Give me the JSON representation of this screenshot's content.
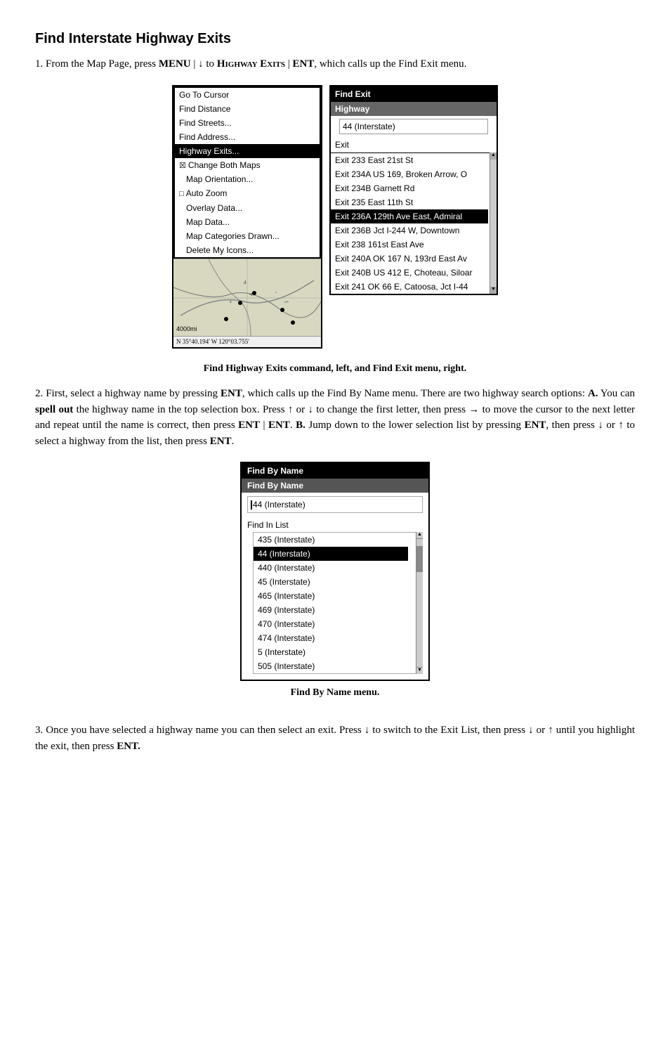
{
  "title": "Find Interstate Highway Exits",
  "paragraph1_parts": [
    {
      "text": "1. From the Map Page, press ",
      "bold": false
    },
    {
      "text": "MENU",
      "bold": true
    },
    {
      "text": " | ↓ to ",
      "bold": false
    },
    {
      "text": "Highway Exits",
      "bold": true,
      "smallcaps": true
    },
    {
      "text": " | ",
      "bold": false
    },
    {
      "text": "ENT",
      "bold": true
    },
    {
      "text": ", which calls up the Find Exit menu.",
      "bold": false
    }
  ],
  "left_menu": {
    "items": [
      {
        "label": "Go To Cursor",
        "type": "normal"
      },
      {
        "label": "Find Distance",
        "type": "normal"
      },
      {
        "label": "Find Streets...",
        "type": "normal"
      },
      {
        "label": "Find Address...",
        "type": "normal"
      },
      {
        "label": "Highway Exits...",
        "type": "selected"
      },
      {
        "label": "Change Both Maps",
        "type": "checkbox"
      },
      {
        "label": "Map Orientation...",
        "type": "normal",
        "indent": true
      },
      {
        "label": "Auto Zoom",
        "type": "checkbox-unchecked"
      },
      {
        "label": "Overlay Data...",
        "type": "normal",
        "indent": true
      },
      {
        "label": "Map Data...",
        "type": "normal",
        "indent": true
      },
      {
        "label": "Map Categories Drawn...",
        "type": "normal",
        "indent": true
      },
      {
        "label": "Delete My Icons...",
        "type": "normal",
        "indent": true
      }
    ],
    "bottom_left": "4000mi",
    "bottom_coords": "N  35°40.194'  W 120°03.755'"
  },
  "find_exit_panel": {
    "header": "Find Exit",
    "subheader": "Highway",
    "input_value": "44 (Interstate)",
    "section_label": "Exit",
    "exits": [
      {
        "label": "Exit 233 East 21st St",
        "selected": false
      },
      {
        "label": "Exit 234A US 169, Broken Arrow, O",
        "selected": false
      },
      {
        "label": "Exit 234B Garnett Rd",
        "selected": false
      },
      {
        "label": "Exit 235 East 11th St",
        "selected": false
      },
      {
        "label": "Exit 236A 129th Ave East, Admiral",
        "selected": true
      },
      {
        "label": "Exit 236B Jct I-244 W, Downtown",
        "selected": false
      },
      {
        "label": "Exit 238 161st East Ave",
        "selected": false
      },
      {
        "label": "Exit 240A OK 167 N, 193rd East Av",
        "selected": false
      },
      {
        "label": "Exit 240B US 412 E, Choteau, Siloar",
        "selected": false
      },
      {
        "label": "Exit 241 OK 66 E, Catoosa, Jct I-44",
        "selected": false
      }
    ]
  },
  "figure1_caption": "Find Highway Exits command, left, and Find Exit menu, right.",
  "paragraph2_parts": [
    {
      "text": "2. First, select a highway name by pressing ",
      "bold": false
    },
    {
      "text": "ENT",
      "bold": true
    },
    {
      "text": ", which calls up the Find By Name menu. There are two highway search options: ",
      "bold": false
    },
    {
      "text": "A.",
      "bold": true
    },
    {
      "text": " You can ",
      "bold": false
    },
    {
      "text": "spell out",
      "bold": true
    },
    {
      "text": " the highway name in the top selection box. Press ↑ or ↓ to change the first letter, then press → to move the cursor to the next letter and repeat until the name is correct, then press ",
      "bold": false
    },
    {
      "text": "ENT",
      "bold": true
    },
    {
      "text": " | ",
      "bold": false
    },
    {
      "text": "ENT",
      "bold": true
    },
    {
      "text": ". ",
      "bold": false
    },
    {
      "text": "B.",
      "bold": true
    },
    {
      "text": " Jump down to the lower selection list by pressing ",
      "bold": false
    },
    {
      "text": "ENT",
      "bold": true
    },
    {
      "text": ", then press ↓ or ↑ to select a highway from the list, then press ",
      "bold": false
    },
    {
      "text": "ENT",
      "bold": true
    },
    {
      "text": ".",
      "bold": false
    }
  ],
  "find_by_name": {
    "header": "Find By Name",
    "subheader": "Find By Name",
    "input_value": "44 (Interstate)",
    "section_label": "Find In List",
    "list_items": [
      {
        "label": "435 (Interstate)",
        "selected": false
      },
      {
        "label": "44 (Interstate)",
        "selected": true
      },
      {
        "label": "440 (Interstate)",
        "selected": false
      },
      {
        "label": "45 (Interstate)",
        "selected": false
      },
      {
        "label": "465 (Interstate)",
        "selected": false
      },
      {
        "label": "469 (Interstate)",
        "selected": false
      },
      {
        "label": "470 (Interstate)",
        "selected": false
      },
      {
        "label": "474 (Interstate)",
        "selected": false
      },
      {
        "label": "5 (Interstate)",
        "selected": false
      },
      {
        "label": "505 (Interstate)",
        "selected": false
      }
    ]
  },
  "figure2_caption": "Find By Name menu.",
  "paragraph3_parts": [
    {
      "text": "3. Once you have selected a highway name you can then select an exit. Press ↓ to switch to the Exit List, then press ↓ or ↑ until you highlight the exit, then press ",
      "bold": false
    },
    {
      "text": "ENT.",
      "bold": true
    }
  ],
  "or_label": "or"
}
